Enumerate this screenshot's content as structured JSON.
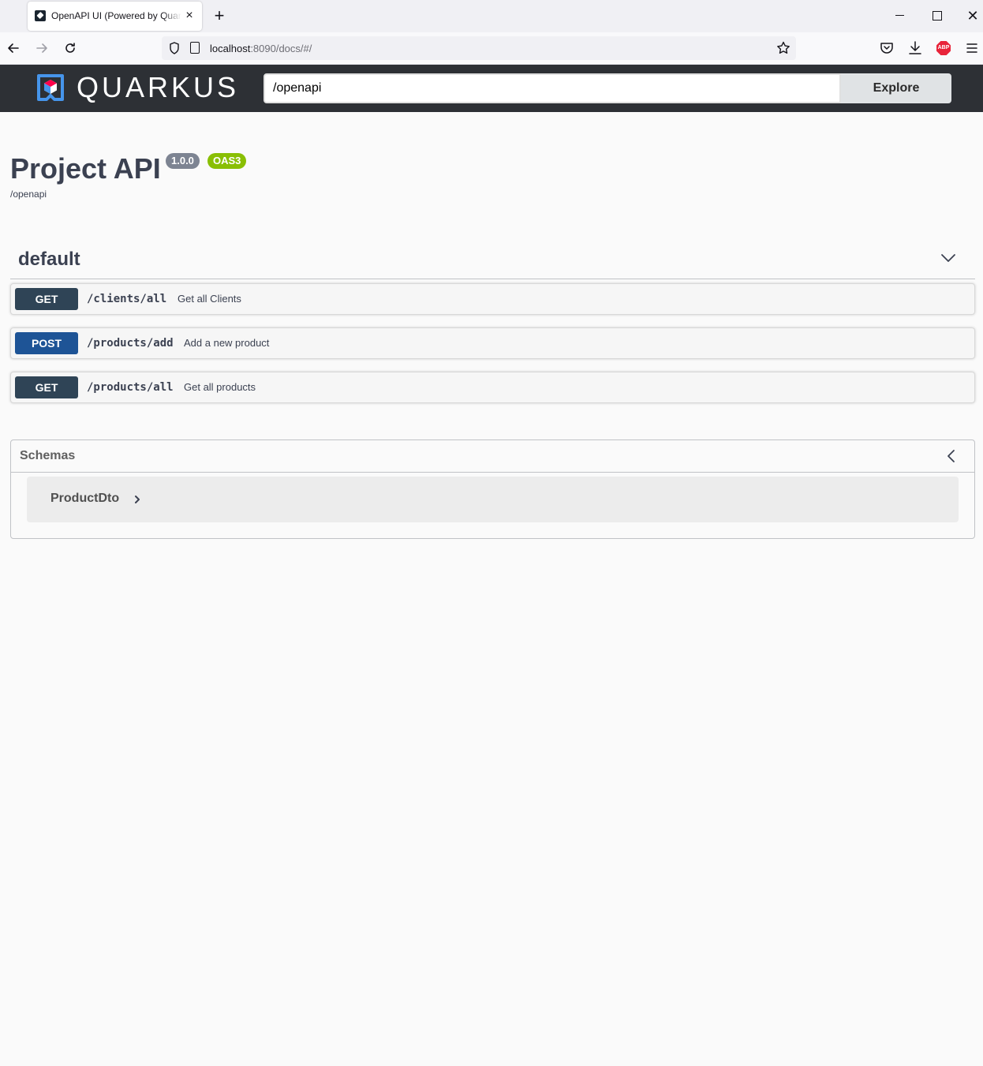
{
  "browser": {
    "tab_title": "OpenAPI UI (Powered by Quarkus)",
    "tab_close": "×",
    "new_tab": "+",
    "win_close": "✕",
    "url_host": "localhost",
    "url_rest": ":8090/docs/#/"
  },
  "topbar": {
    "brand": "QUARKUS",
    "spec_url": "/openapi",
    "explore_label": "Explore"
  },
  "info": {
    "title": "Project API",
    "version": "1.0.0",
    "oas_badge": "OAS3",
    "spec_link": "/openapi"
  },
  "group": {
    "name": "default",
    "operations": [
      {
        "method": "GET",
        "path": "/clients/all",
        "summary": "Get all Clients"
      },
      {
        "method": "POST",
        "path": "/products/add",
        "summary": "Add a new product"
      },
      {
        "method": "GET",
        "path": "/products/all",
        "summary": "Get all products"
      }
    ]
  },
  "schemas": {
    "title": "Schemas",
    "models": [
      {
        "name": "ProductDto"
      }
    ]
  },
  "colors": {
    "topbar_bg": "#2d3035",
    "get_method": "#2f4456",
    "post_method": "#1e5496",
    "version_badge": "#7d8492",
    "oas_badge": "#89bf04",
    "quarkus_blue": "#4695eb",
    "quarkus_red": "#ff004a"
  }
}
